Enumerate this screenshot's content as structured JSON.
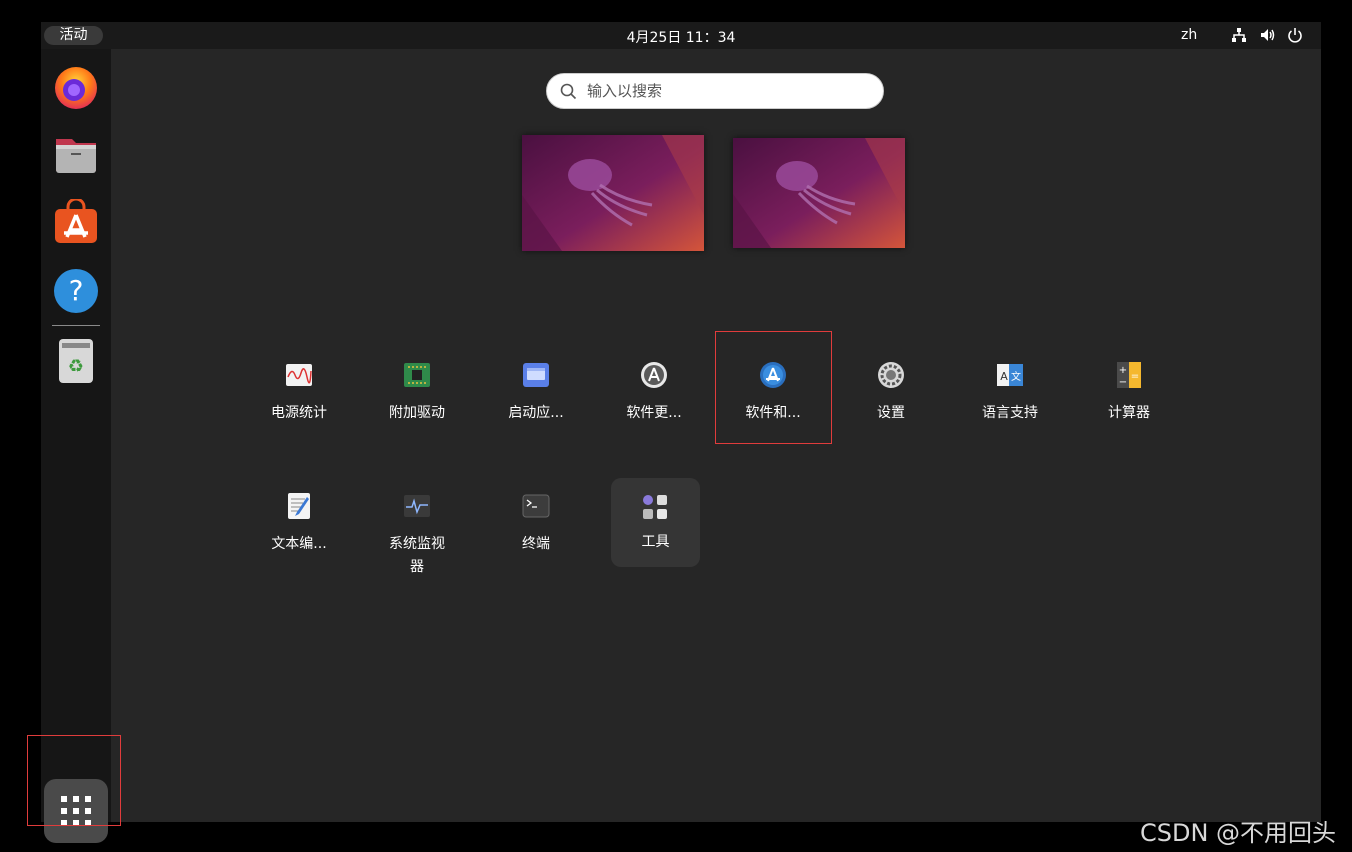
{
  "topbar": {
    "activities_label": "活动",
    "clock": "4月25日  11：34",
    "input_method": "zh",
    "tray_icons": [
      "network-icon",
      "volume-icon",
      "power-icon"
    ]
  },
  "dock": {
    "apps": [
      {
        "name": "firefox-icon"
      },
      {
        "name": "files-icon"
      },
      {
        "name": "software-store-icon"
      },
      {
        "name": "help-icon"
      },
      {
        "name": "trash-icon"
      }
    ],
    "show_apps_icon": "grid-icon"
  },
  "search": {
    "placeholder": "输入以搜索"
  },
  "workspaces": [
    "workspace-1",
    "workspace-2"
  ],
  "apps": [
    {
      "label": "电源统计",
      "icon": "power-statistics-icon"
    },
    {
      "label": "附加驱动",
      "icon": "additional-drivers-icon"
    },
    {
      "label": "启动应...",
      "icon": "startup-applications-icon"
    },
    {
      "label": "软件更...",
      "icon": "software-updater-icon"
    },
    {
      "label": "软件和...",
      "icon": "software-and-updates-icon"
    },
    {
      "label": "设置",
      "icon": "settings-icon"
    },
    {
      "label": "语言支持",
      "icon": "language-support-icon"
    },
    {
      "label": "计算器",
      "icon": "calculator-icon"
    },
    {
      "label": "文本编...",
      "icon": "text-editor-icon"
    },
    {
      "label": "系统监视\n器",
      "icon": "system-monitor-icon"
    },
    {
      "label": "终端",
      "icon": "terminal-icon"
    },
    {
      "label": "工具",
      "icon": "utilities-folder-icon"
    }
  ],
  "colors": {
    "highlight": "#e03c3c",
    "background": "#262626",
    "topbar": "#1a1a1a",
    "dock": "#161616"
  },
  "watermark": "CSDN @不用回头"
}
